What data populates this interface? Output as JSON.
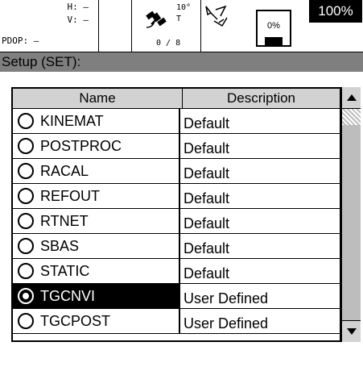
{
  "status": {
    "h": "H: –",
    "v": "V: –",
    "pdop": "PDOP: –",
    "sat_elevation": "10°",
    "sat_t": "T",
    "sat_count": "0 / 8",
    "memory": "0%",
    "memory_level": 0,
    "battery": "100%"
  },
  "header": {
    "title": "Setup (SET):"
  },
  "table": {
    "columns": {
      "name": "Name",
      "description": "Description"
    },
    "rows": [
      {
        "name": "KINEMAT",
        "description": "Default",
        "checked": false,
        "selected": false
      },
      {
        "name": "POSTPROC",
        "description": "Default",
        "checked": false,
        "selected": false
      },
      {
        "name": "RACAL",
        "description": "Default",
        "checked": false,
        "selected": false
      },
      {
        "name": "REFOUT",
        "description": "Default",
        "checked": false,
        "selected": false
      },
      {
        "name": "RTNET",
        "description": "Default",
        "checked": false,
        "selected": false
      },
      {
        "name": "SBAS",
        "description": "Default",
        "checked": false,
        "selected": false
      },
      {
        "name": "STATIC",
        "description": "Default",
        "checked": false,
        "selected": false
      },
      {
        "name": "TGCNVI",
        "description": "User Defined",
        "checked": true,
        "selected": true
      },
      {
        "name": "TGCPOST",
        "description": "User Defined",
        "checked": false,
        "selected": false
      }
    ]
  },
  "icons": {
    "satellite": "satellite-icon",
    "link": "link-icon",
    "memory": "memory-card-icon",
    "scroll_up": "arrow-up-icon",
    "scroll_down": "arrow-down-icon"
  }
}
